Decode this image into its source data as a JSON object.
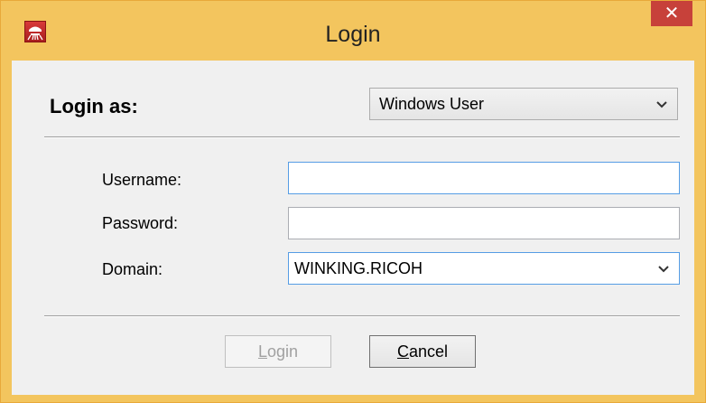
{
  "window": {
    "title": "Login",
    "close_glyph": "✕",
    "app_icon": "app-logo-icon"
  },
  "login_as": {
    "label": "Login as:",
    "selected": "Windows User",
    "options": [
      "Windows User"
    ]
  },
  "fields": {
    "username": {
      "label": "Username:",
      "value": "",
      "focused": true
    },
    "password": {
      "label": "Password:",
      "value": ""
    },
    "domain": {
      "label": "Domain:",
      "value": "WINKING.RICOH"
    }
  },
  "buttons": {
    "login": {
      "mnemonic": "L",
      "rest": "ogin",
      "enabled": false
    },
    "cancel": {
      "mnemonic": "C",
      "rest": "ancel",
      "enabled": true
    }
  },
  "colors": {
    "titlebar": "#f3c55e",
    "close_button": "#c7413a",
    "focus_border": "#569de5"
  }
}
